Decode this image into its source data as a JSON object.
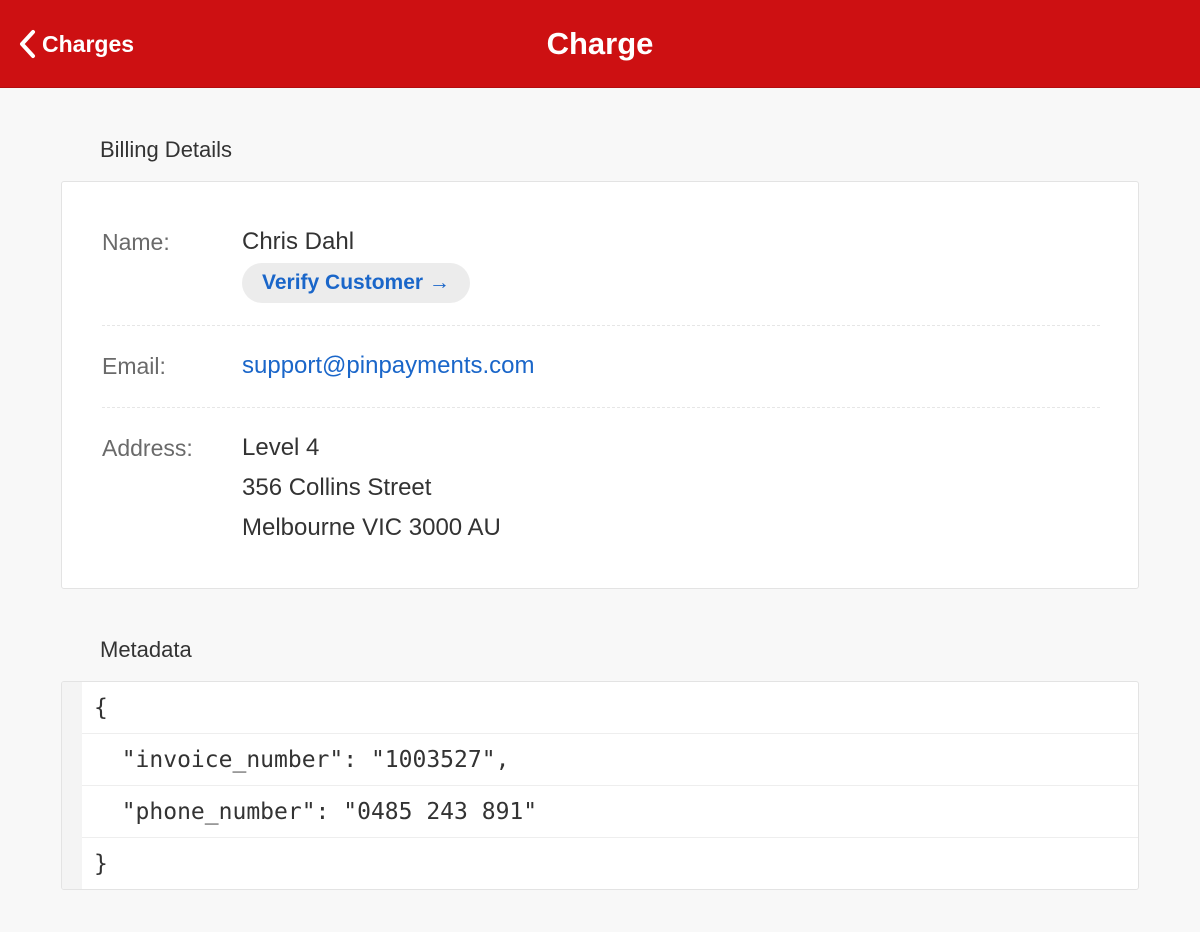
{
  "nav": {
    "back_label": "Charges",
    "title": "Charge"
  },
  "billing": {
    "section_title": "Billing Details",
    "name_label": "Name:",
    "name_value": "Chris Dahl",
    "verify_label": "Verify Customer →",
    "email_label": "Email:",
    "email_value": "support@pinpayments.com",
    "address_label": "Address:",
    "address_lines": [
      "Level 4",
      "356 Collins Street",
      "Melbourne VIC 3000 AU"
    ]
  },
  "metadata": {
    "section_title": "Metadata",
    "lines": [
      "{",
      "  \"invoice_number\": \"1003527\",",
      "  \"phone_number\": \"0485 243 891\"",
      "}"
    ]
  },
  "colors": {
    "nav_background": "#cd1012",
    "link": "#1a66c9"
  },
  "icons": {
    "back": "chevron-left-icon"
  }
}
